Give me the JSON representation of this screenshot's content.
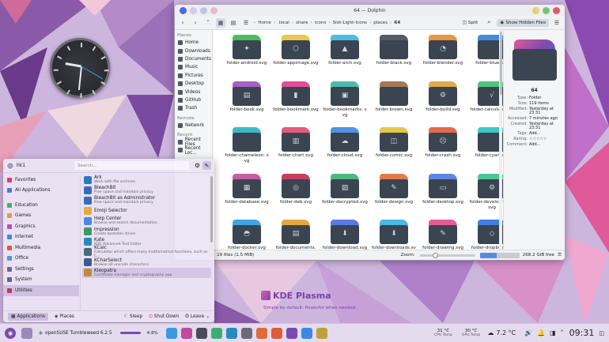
{
  "clock_widget": {
    "label": "analog clock"
  },
  "dolphin": {
    "title": "64 — Dolphin",
    "toolbar": {
      "split": "Split",
      "show_hidden": "Show Hidden Files"
    },
    "breadcrumb": [
      "Home",
      ".local",
      "share",
      "icons",
      "Slot-Light-Icons",
      "places",
      "64"
    ],
    "sidebar": {
      "places_header": "Places",
      "places": [
        "Home",
        "Downloads",
        "Documents",
        "Music",
        "Pictures",
        "Desktop",
        "Videos",
        "GitHub",
        "Trash"
      ],
      "remote_header": "Remote",
      "remote": [
        "Network"
      ],
      "recent_header": "Recent",
      "recent": [
        "Recent Files",
        "Recent Loc..."
      ]
    },
    "files": [
      {
        "name": "folder-android.svg",
        "color": "#3cb54a",
        "glyph": "✦"
      },
      {
        "name": "folder-appimage.svg",
        "color": "#e8c13a",
        "glyph": "⬡"
      },
      {
        "name": "folder-arch.svg",
        "color": "#3cb2e0",
        "glyph": "▲"
      },
      {
        "name": "folder-black.svg",
        "color": "#444a56",
        "glyph": ""
      },
      {
        "name": "folder-blender.svg",
        "color": "#e88a2a",
        "glyph": "◔"
      },
      {
        "name": "folder-blue.svg",
        "color": "#2c7fdc",
        "glyph": ""
      },
      {
        "name": "folder-book.svg",
        "color": "#9c4fc0",
        "glyph": "▤"
      },
      {
        "name": "folder-bookmark.svg",
        "color": "#e03c8a",
        "glyph": "▮"
      },
      {
        "name": "folder-bookmarks.svg",
        "color": "#3cb2a0",
        "glyph": "▣"
      },
      {
        "name": "folder-brown.svg",
        "color": "#9c6a40",
        "glyph": ""
      },
      {
        "name": "folder-build.svg",
        "color": "#e0a03a",
        "glyph": "⚙"
      },
      {
        "name": "folder-calculate.svg",
        "color": "#3cc070",
        "glyph": "√"
      },
      {
        "name": "folder-chameleon.svg",
        "color": "#2ab0c0",
        "glyph": ""
      },
      {
        "name": "folder-chart.svg",
        "color": "#e04a6a",
        "glyph": "▥"
      },
      {
        "name": "folder-cloud.svg",
        "color": "#3a8ae0",
        "glyph": "☁"
      },
      {
        "name": "folder-comic.svg",
        "color": "#e0c03a",
        "glyph": "◫"
      },
      {
        "name": "folder-crash.svg",
        "color": "#e05a3a",
        "glyph": "☹"
      },
      {
        "name": "folder-cyan.svg",
        "color": "#2ac0c0",
        "glyph": ""
      },
      {
        "name": "folder-database.svg",
        "color": "#c04a9a",
        "glyph": "▦"
      },
      {
        "name": "folder-deb.svg",
        "color": "#c02a50",
        "glyph": "◎"
      },
      {
        "name": "folder-decrypted.svg",
        "color": "#3ab070",
        "glyph": "▨"
      },
      {
        "name": "folder-design.svg",
        "color": "#e06a3a",
        "glyph": "✎"
      },
      {
        "name": "folder-desktop.svg",
        "color": "#4a7ae0",
        "glyph": "▭"
      },
      {
        "name": "folder-development.svg",
        "color": "#3ac08a",
        "glyph": "⚙"
      },
      {
        "name": "folder-docker.svg",
        "color": "#2a9ae0",
        "glyph": "◓"
      },
      {
        "name": "folder-documents.svg",
        "color": "#e0a02a",
        "glyph": "▤"
      },
      {
        "name": "folder-download.svg",
        "color": "#4a6ae0",
        "glyph": "⬇"
      },
      {
        "name": "folder-downloads.svg",
        "color": "#3ab0e0",
        "glyph": "⬇"
      },
      {
        "name": "folder-drawing.svg",
        "color": "#e04a8a",
        "glyph": "✎"
      },
      {
        "name": "folder-dropbox.svg",
        "color": "#2a70e0",
        "glyph": "◇"
      }
    ],
    "display_names": [
      "folder-android.svg",
      "folder-appimage.svg",
      "folder-arch.svg",
      "folder-black.svg",
      "folder-blender.svg",
      "folder-blue.svg",
      "folder-book.svg",
      "folder-bookmark.svg",
      "folder-bookmarks. svg",
      "folder-brown.svg",
      "folder-build.svg",
      "folder-calculate.svg",
      "folder-chameleon. svg",
      "folder-chart.svg",
      "folder-cloud.svg",
      "folder-comic.svg",
      "folder-crash.svg",
      "folder-cyan.svg",
      "folder-database.svg",
      "folder-deb.svg",
      "folder-decrypted.svg",
      "folder-design.svg",
      "folder-desktop.svg",
      "folder-development. svg",
      "folder-docker.svg",
      "folder-documents.",
      "folder-download.svg",
      "folder-downloads.svg",
      "folder-drawing.svg",
      "folder-dropbox.svg"
    ],
    "info": {
      "name": "64",
      "rows": [
        {
          "k": "Type:",
          "v": "Folder"
        },
        {
          "k": "Size:",
          "v": "119 items"
        },
        {
          "k": "Modified:",
          "v": "Yesterday at 23:31"
        },
        {
          "k": "Accessed:",
          "v": "7 minutes ago"
        },
        {
          "k": "Created:",
          "v": "Yesterday at 23:31"
        },
        {
          "k": "Tags:",
          "v": "Add..."
        },
        {
          "k": "Rating:",
          "v": "☆☆☆☆☆"
        },
        {
          "k": "Comment:",
          "v": "Add..."
        }
      ]
    },
    "status": {
      "count": "19 files (1.5 MiB)",
      "zoom_label": "Zoom:",
      "free": "268.2 GiB free"
    }
  },
  "menu": {
    "user": "hk1",
    "search_placeholder": "Search...",
    "categories": [
      "Favorites",
      "All Applications",
      "Education",
      "Games",
      "Graphics",
      "Internet",
      "Multimedia",
      "Office",
      "Settings",
      "System",
      "Utilities"
    ],
    "category_colors": [
      "#e03c6a",
      "#4a7ae0",
      "#3ab070",
      "#e0a03a",
      "#c04ac0",
      "#3a8ae0",
      "#e05a3a",
      "#4a9ae0",
      "#6a6a80",
      "#5a6a90",
      "#c03a60"
    ],
    "selected_category": "Utilities",
    "apps": [
      {
        "name": "Ark",
        "desc": "Work with file archives",
        "color": "#2a7ac0"
      },
      {
        "name": "BleachBit",
        "desc": "Free space and maintain privacy",
        "color": "#3a6ac0"
      },
      {
        "name": "BleachBit as Administrator",
        "desc": "Free space and maintain privacy",
        "color": "#3a6ac0"
      },
      {
        "name": "Emoji Selector",
        "desc": "",
        "color": "#e0b03a"
      },
      {
        "name": "Help Center",
        "desc": "Browse and search documentation",
        "color": "#4a8ae0"
      },
      {
        "name": "Impression",
        "desc": "Create bootable drives",
        "color": "#3a9a60"
      },
      {
        "name": "Kate",
        "desc": "KDE Advanced Text Editor",
        "color": "#2a8ac0"
      },
      {
        "name": "KCalc",
        "desc": "Calculator which offers many mathematical functions, such as t...",
        "color": "#4a6a80"
      },
      {
        "name": "KCharSelect",
        "desc": "Browse all unicode characters",
        "color": "#3a5a90"
      },
      {
        "name": "Kleopatra",
        "desc": "Certificate manager and cryptography app",
        "color": "#c08a3a"
      }
    ],
    "footer": {
      "applications": "Applications",
      "places": "Places",
      "sleep": "Sleep",
      "shutdown": "Shut Down",
      "leave": "Leave"
    }
  },
  "watermark": {
    "title": "KDE Plasma",
    "subtitle": "Simple by default. Powerful when needed."
  },
  "panel": {
    "os": "openSUSE Tumbleweed 6.2.5",
    "cpu_pct": "4.8%",
    "cpu_temp": "31 °C",
    "cpu_temp_label": "CPU Temp",
    "gpu_temp": "30 °C",
    "gpu_temp_label": "GPU Temp",
    "weather": "7.2 °C",
    "time": "09:31",
    "tasks": [
      "#3a9ae0",
      "#c04a9a",
      "#4a4a5a",
      "#3ab070",
      "#2a8ac0",
      "#6a6a7a",
      "#e06a3a",
      "#e05a3a",
      "#7a4ab0",
      "#3a8ae0",
      "#c0a03a"
    ]
  },
  "colors": {
    "accent": "#7a3fb0",
    "selection": "#d4dbe6"
  }
}
